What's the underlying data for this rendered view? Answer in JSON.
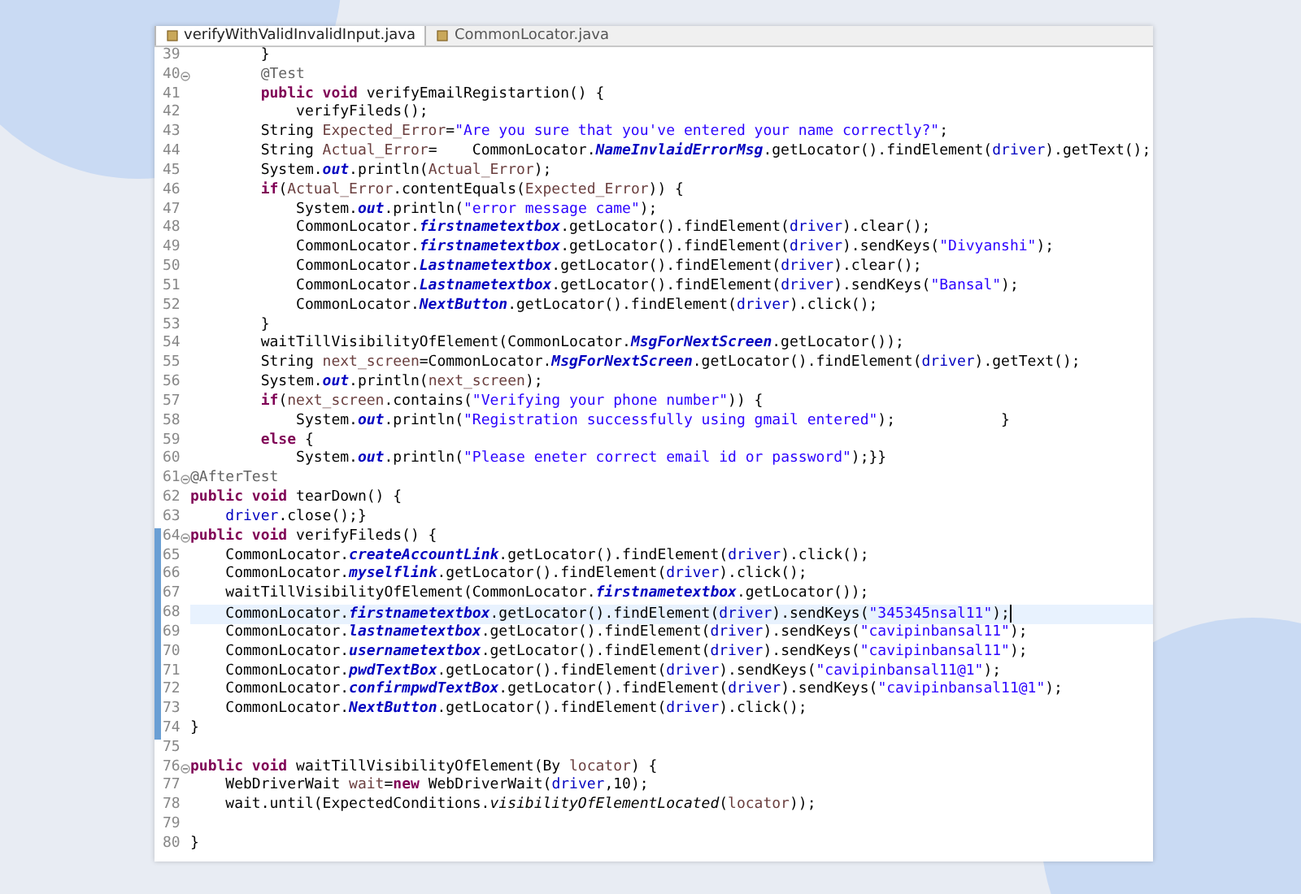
{
  "tabs": [
    {
      "label": "verifyWithValidInvalidInput.java",
      "selected": true
    },
    {
      "label": "CommonLocator.java",
      "selected": false
    }
  ],
  "lines": [
    {
      "number": "39",
      "fold": false,
      "changed": false,
      "current": false,
      "tokens": [
        {
          "kind": "p",
          "text": "        }"
        }
      ]
    },
    {
      "number": "40",
      "fold": true,
      "changed": false,
      "current": false,
      "tokens": [
        {
          "kind": "a",
          "text": "        @Test"
        }
      ]
    },
    {
      "number": "41",
      "fold": false,
      "changed": false,
      "current": false,
      "tokens": [
        {
          "kind": "k",
          "text": "        public void"
        },
        {
          "kind": "p",
          "text": " verifyEmailRegistartion() {"
        }
      ]
    },
    {
      "number": "42",
      "fold": false,
      "changed": false,
      "current": false,
      "tokens": [
        {
          "kind": "p",
          "text": "            verifyFileds();"
        }
      ]
    },
    {
      "number": "43",
      "fold": false,
      "changed": false,
      "current": false,
      "tokens": [
        {
          "kind": "p",
          "text": "        String "
        },
        {
          "kind": "v",
          "text": "Expected_Error"
        },
        {
          "kind": "p",
          "text": "="
        },
        {
          "kind": "s",
          "text": "\"Are you sure that you've entered your name correctly?\""
        },
        {
          "kind": "p",
          "text": ";"
        }
      ]
    },
    {
      "number": "44",
      "fold": false,
      "changed": false,
      "current": false,
      "tokens": [
        {
          "kind": "p",
          "text": "        String "
        },
        {
          "kind": "v",
          "text": "Actual_Error"
        },
        {
          "kind": "p",
          "text": "=    CommonLocator."
        },
        {
          "kind": "f",
          "text": "NameInvlaidErrorMsg"
        },
        {
          "kind": "p",
          "text": ".getLocator().findElement("
        },
        {
          "kind": "d",
          "text": "driver"
        },
        {
          "kind": "p",
          "text": ").getText();"
        }
      ]
    },
    {
      "number": "45",
      "fold": false,
      "changed": false,
      "current": false,
      "tokens": [
        {
          "kind": "p",
          "text": "        System."
        },
        {
          "kind": "f",
          "text": "out"
        },
        {
          "kind": "p",
          "text": ".println("
        },
        {
          "kind": "v",
          "text": "Actual_Error"
        },
        {
          "kind": "p",
          "text": ");"
        }
      ]
    },
    {
      "number": "46",
      "fold": false,
      "changed": false,
      "current": false,
      "tokens": [
        {
          "kind": "k",
          "text": "        if"
        },
        {
          "kind": "p",
          "text": "("
        },
        {
          "kind": "v",
          "text": "Actual_Error"
        },
        {
          "kind": "p",
          "text": ".contentEquals("
        },
        {
          "kind": "v",
          "text": "Expected_Error"
        },
        {
          "kind": "p",
          "text": ")) {"
        }
      ]
    },
    {
      "number": "47",
      "fold": false,
      "changed": false,
      "current": false,
      "tokens": [
        {
          "kind": "p",
          "text": "            System."
        },
        {
          "kind": "f",
          "text": "out"
        },
        {
          "kind": "p",
          "text": ".println("
        },
        {
          "kind": "s",
          "text": "\"error message came\""
        },
        {
          "kind": "p",
          "text": ");"
        }
      ]
    },
    {
      "number": "48",
      "fold": false,
      "changed": false,
      "current": false,
      "tokens": [
        {
          "kind": "p",
          "text": "            CommonLocator."
        },
        {
          "kind": "f",
          "text": "firstnametextbox"
        },
        {
          "kind": "p",
          "text": ".getLocator().findElement("
        },
        {
          "kind": "d",
          "text": "driver"
        },
        {
          "kind": "p",
          "text": ").clear();"
        }
      ]
    },
    {
      "number": "49",
      "fold": false,
      "changed": false,
      "current": false,
      "tokens": [
        {
          "kind": "p",
          "text": "            CommonLocator."
        },
        {
          "kind": "f",
          "text": "firstnametextbox"
        },
        {
          "kind": "p",
          "text": ".getLocator().findElement("
        },
        {
          "kind": "d",
          "text": "driver"
        },
        {
          "kind": "p",
          "text": ").sendKeys("
        },
        {
          "kind": "s",
          "text": "\"Divyanshi\""
        },
        {
          "kind": "p",
          "text": ");"
        }
      ]
    },
    {
      "number": "50",
      "fold": false,
      "changed": false,
      "current": false,
      "tokens": [
        {
          "kind": "p",
          "text": "            CommonLocator."
        },
        {
          "kind": "f",
          "text": "Lastnametextbox"
        },
        {
          "kind": "p",
          "text": ".getLocator().findElement("
        },
        {
          "kind": "d",
          "text": "driver"
        },
        {
          "kind": "p",
          "text": ").clear();"
        }
      ]
    },
    {
      "number": "51",
      "fold": false,
      "changed": false,
      "current": false,
      "tokens": [
        {
          "kind": "p",
          "text": "            CommonLocator."
        },
        {
          "kind": "f",
          "text": "Lastnametextbox"
        },
        {
          "kind": "p",
          "text": ".getLocator().findElement("
        },
        {
          "kind": "d",
          "text": "driver"
        },
        {
          "kind": "p",
          "text": ").sendKeys("
        },
        {
          "kind": "s",
          "text": "\"Bansal\""
        },
        {
          "kind": "p",
          "text": ");"
        }
      ]
    },
    {
      "number": "52",
      "fold": false,
      "changed": false,
      "current": false,
      "tokens": [
        {
          "kind": "p",
          "text": "            CommonLocator."
        },
        {
          "kind": "f",
          "text": "NextButton"
        },
        {
          "kind": "p",
          "text": ".getLocator().findElement("
        },
        {
          "kind": "d",
          "text": "driver"
        },
        {
          "kind": "p",
          "text": ").click();"
        }
      ]
    },
    {
      "number": "53",
      "fold": false,
      "changed": false,
      "current": false,
      "tokens": [
        {
          "kind": "p",
          "text": "        }"
        }
      ]
    },
    {
      "number": "54",
      "fold": false,
      "changed": false,
      "current": false,
      "tokens": [
        {
          "kind": "p",
          "text": "        waitTillVisibilityOfElement(CommonLocator."
        },
        {
          "kind": "f",
          "text": "MsgForNextScreen"
        },
        {
          "kind": "p",
          "text": ".getLocator());"
        }
      ]
    },
    {
      "number": "55",
      "fold": false,
      "changed": false,
      "current": false,
      "tokens": [
        {
          "kind": "p",
          "text": "        String "
        },
        {
          "kind": "v",
          "text": "next_screen"
        },
        {
          "kind": "p",
          "text": "=CommonLocator."
        },
        {
          "kind": "f",
          "text": "MsgForNextScreen"
        },
        {
          "kind": "p",
          "text": ".getLocator().findElement("
        },
        {
          "kind": "d",
          "text": "driver"
        },
        {
          "kind": "p",
          "text": ").getText();"
        }
      ]
    },
    {
      "number": "56",
      "fold": false,
      "changed": false,
      "current": false,
      "tokens": [
        {
          "kind": "p",
          "text": "        System."
        },
        {
          "kind": "f",
          "text": "out"
        },
        {
          "kind": "p",
          "text": ".println("
        },
        {
          "kind": "v",
          "text": "next_screen"
        },
        {
          "kind": "p",
          "text": ");"
        }
      ]
    },
    {
      "number": "57",
      "fold": false,
      "changed": false,
      "current": false,
      "tokens": [
        {
          "kind": "k",
          "text": "        if"
        },
        {
          "kind": "p",
          "text": "("
        },
        {
          "kind": "v",
          "text": "next_screen"
        },
        {
          "kind": "p",
          "text": ".contains("
        },
        {
          "kind": "s",
          "text": "\"Verifying your phone number\""
        },
        {
          "kind": "p",
          "text": ")) {"
        }
      ]
    },
    {
      "number": "58",
      "fold": false,
      "changed": false,
      "current": false,
      "tokens": [
        {
          "kind": "p",
          "text": "            System."
        },
        {
          "kind": "f",
          "text": "out"
        },
        {
          "kind": "p",
          "text": ".println("
        },
        {
          "kind": "s",
          "text": "\"Registration successfully using gmail entered\""
        },
        {
          "kind": "p",
          "text": ");            }"
        }
      ]
    },
    {
      "number": "59",
      "fold": false,
      "changed": false,
      "current": false,
      "tokens": [
        {
          "kind": "k",
          "text": "        else"
        },
        {
          "kind": "p",
          "text": " {"
        }
      ]
    },
    {
      "number": "60",
      "fold": false,
      "changed": false,
      "current": false,
      "tokens": [
        {
          "kind": "p",
          "text": "            System."
        },
        {
          "kind": "f",
          "text": "out"
        },
        {
          "kind": "p",
          "text": ".println("
        },
        {
          "kind": "s",
          "text": "\"Please eneter correct email id or password\""
        },
        {
          "kind": "p",
          "text": ");}}"
        }
      ]
    },
    {
      "number": "61",
      "fold": true,
      "changed": false,
      "current": false,
      "tokens": [
        {
          "kind": "a",
          "text": "@AfterTest"
        }
      ]
    },
    {
      "number": "62",
      "fold": false,
      "changed": false,
      "current": false,
      "tokens": [
        {
          "kind": "k",
          "text": "public void"
        },
        {
          "kind": "p",
          "text": " tearDown() {"
        }
      ]
    },
    {
      "number": "63",
      "fold": false,
      "changed": false,
      "current": false,
      "tokens": [
        {
          "kind": "d",
          "text": "    driver"
        },
        {
          "kind": "p",
          "text": ".close();}"
        }
      ]
    },
    {
      "number": "64",
      "fold": true,
      "changed": true,
      "current": false,
      "tokens": [
        {
          "kind": "k",
          "text": "public void"
        },
        {
          "kind": "p",
          "text": " verifyFileds() {"
        }
      ]
    },
    {
      "number": "65",
      "fold": false,
      "changed": true,
      "current": false,
      "tokens": [
        {
          "kind": "p",
          "text": "    CommonLocator."
        },
        {
          "kind": "f",
          "text": "createAccountLink"
        },
        {
          "kind": "p",
          "text": ".getLocator().findElement("
        },
        {
          "kind": "d",
          "text": "driver"
        },
        {
          "kind": "p",
          "text": ").click();"
        }
      ]
    },
    {
      "number": "66",
      "fold": false,
      "changed": true,
      "current": false,
      "tokens": [
        {
          "kind": "p",
          "text": "    CommonLocator."
        },
        {
          "kind": "f",
          "text": "myselflink"
        },
        {
          "kind": "p",
          "text": ".getLocator().findElement("
        },
        {
          "kind": "d",
          "text": "driver"
        },
        {
          "kind": "p",
          "text": ").click();"
        }
      ]
    },
    {
      "number": "67",
      "fold": false,
      "changed": true,
      "current": false,
      "tokens": [
        {
          "kind": "p",
          "text": "    waitTillVisibilityOfElement(CommonLocator."
        },
        {
          "kind": "f",
          "text": "firstnametextbox"
        },
        {
          "kind": "p",
          "text": ".getLocator());"
        }
      ]
    },
    {
      "number": "68",
      "fold": false,
      "changed": true,
      "current": true,
      "tokens": [
        {
          "kind": "p",
          "text": "    CommonLocator."
        },
        {
          "kind": "f",
          "text": "firstnametextbox"
        },
        {
          "kind": "p",
          "text": ".getLocator().findElement("
        },
        {
          "kind": "d",
          "text": "driver"
        },
        {
          "kind": "p",
          "text": ").sendKeys("
        },
        {
          "kind": "s",
          "text": "\"345345nsal11\""
        },
        {
          "kind": "p",
          "text": ");"
        }
      ]
    },
    {
      "number": "69",
      "fold": false,
      "changed": true,
      "current": false,
      "tokens": [
        {
          "kind": "p",
          "text": "    CommonLocator."
        },
        {
          "kind": "f",
          "text": "lastnametextbox"
        },
        {
          "kind": "p",
          "text": ".getLocator().findElement("
        },
        {
          "kind": "d",
          "text": "driver"
        },
        {
          "kind": "p",
          "text": ").sendKeys("
        },
        {
          "kind": "s",
          "text": "\"cavipinbansal11\""
        },
        {
          "kind": "p",
          "text": ");"
        }
      ]
    },
    {
      "number": "70",
      "fold": false,
      "changed": true,
      "current": false,
      "tokens": [
        {
          "kind": "p",
          "text": "    CommonLocator."
        },
        {
          "kind": "f",
          "text": "usernametextbox"
        },
        {
          "kind": "p",
          "text": ".getLocator().findElement("
        },
        {
          "kind": "d",
          "text": "driver"
        },
        {
          "kind": "p",
          "text": ").sendKeys("
        },
        {
          "kind": "s",
          "text": "\"cavipinbansal11\""
        },
        {
          "kind": "p",
          "text": ");"
        }
      ]
    },
    {
      "number": "71",
      "fold": false,
      "changed": true,
      "current": false,
      "tokens": [
        {
          "kind": "p",
          "text": "    CommonLocator."
        },
        {
          "kind": "f",
          "text": "pwdTextBox"
        },
        {
          "kind": "p",
          "text": ".getLocator().findElement("
        },
        {
          "kind": "d",
          "text": "driver"
        },
        {
          "kind": "p",
          "text": ").sendKeys("
        },
        {
          "kind": "s",
          "text": "\"cavipinbansal11@1\""
        },
        {
          "kind": "p",
          "text": ");"
        }
      ]
    },
    {
      "number": "72",
      "fold": false,
      "changed": true,
      "current": false,
      "tokens": [
        {
          "kind": "p",
          "text": "    CommonLocator."
        },
        {
          "kind": "f",
          "text": "confirmpwdTextBox"
        },
        {
          "kind": "p",
          "text": ".getLocator().findElement("
        },
        {
          "kind": "d",
          "text": "driver"
        },
        {
          "kind": "p",
          "text": ").sendKeys("
        },
        {
          "kind": "s",
          "text": "\"cavipinbansal11@1\""
        },
        {
          "kind": "p",
          "text": ");"
        }
      ]
    },
    {
      "number": "73",
      "fold": false,
      "changed": true,
      "current": false,
      "tokens": [
        {
          "kind": "p",
          "text": "    CommonLocator."
        },
        {
          "kind": "f",
          "text": "NextButton"
        },
        {
          "kind": "p",
          "text": ".getLocator().findElement("
        },
        {
          "kind": "d",
          "text": "driver"
        },
        {
          "kind": "p",
          "text": ").click();"
        }
      ]
    },
    {
      "number": "74",
      "fold": false,
      "changed": true,
      "current": false,
      "tokens": [
        {
          "kind": "p",
          "text": "}"
        }
      ]
    },
    {
      "number": "75",
      "fold": false,
      "changed": false,
      "current": false
    },
    {
      "number": "76",
      "fold": true,
      "changed": false,
      "current": false,
      "tokens": [
        {
          "kind": "k",
          "text": "public void"
        },
        {
          "kind": "p",
          "text": " waitTillVisibilityOfElement(By "
        },
        {
          "kind": "v",
          "text": "locator"
        },
        {
          "kind": "p",
          "text": ") {"
        }
      ]
    },
    {
      "number": "77",
      "fold": false,
      "changed": false,
      "current": false,
      "tokens": [
        {
          "kind": "p",
          "text": "    WebDriverWait "
        },
        {
          "kind": "v",
          "text": "wait"
        },
        {
          "kind": "p",
          "text": "="
        },
        {
          "kind": "k",
          "text": "new"
        },
        {
          "kind": "p",
          "text": " WebDriverWait("
        },
        {
          "kind": "d",
          "text": "driver"
        },
        {
          "kind": "p",
          "text": ",10);"
        }
      ]
    },
    {
      "number": "78",
      "fold": false,
      "changed": false,
      "current": false,
      "tokens": [
        {
          "kind": "p",
          "text": "    wait.until(ExpectedConditions."
        },
        {
          "kind": "i",
          "text": "visibilityOfElementLocated"
        },
        {
          "kind": "p",
          "text": "("
        },
        {
          "kind": "v",
          "text": "locator"
        },
        {
          "kind": "p",
          "text": "));"
        }
      ]
    },
    {
      "number": "79",
      "fold": false,
      "changed": false,
      "current": false
    },
    {
      "number": "80",
      "fold": false,
      "changed": false,
      "current": false,
      "tokens": [
        {
          "kind": "p",
          "text": "}"
        }
      ]
    }
  ]
}
